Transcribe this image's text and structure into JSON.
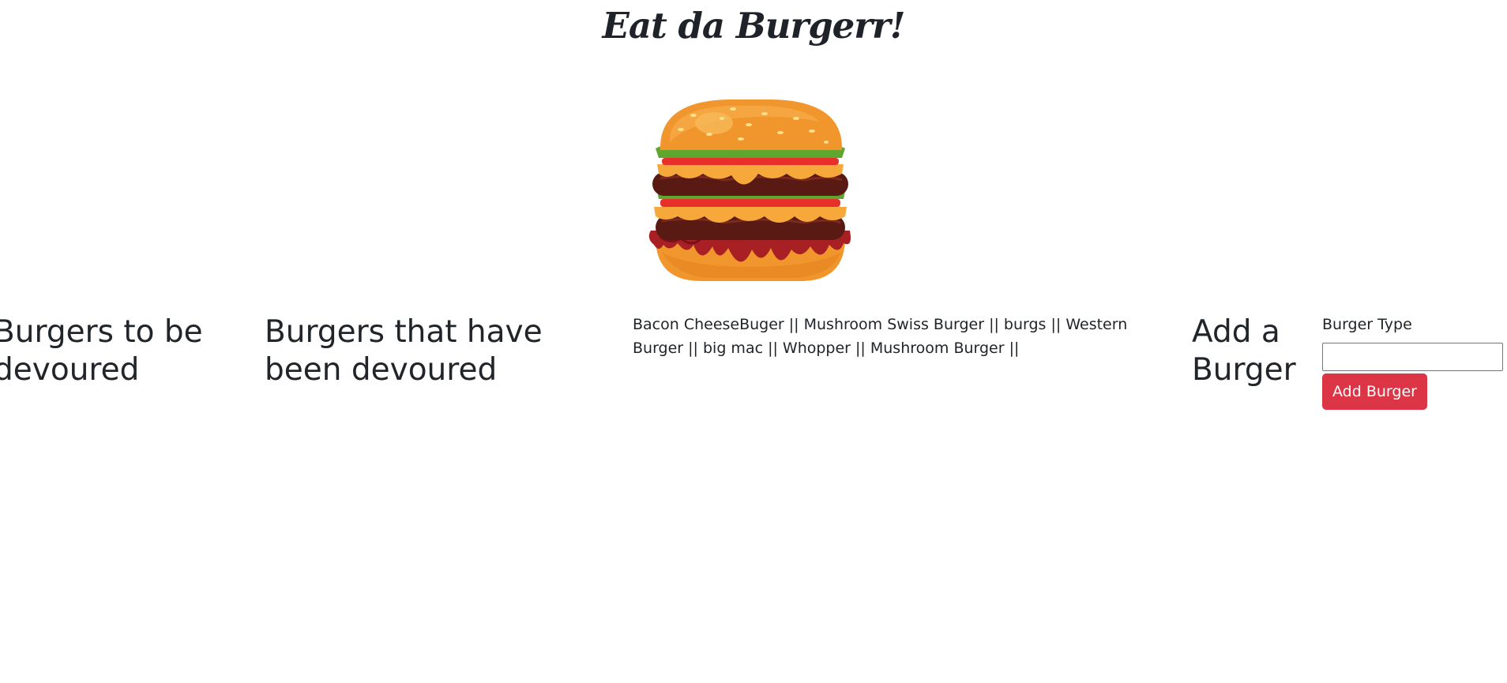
{
  "header": {
    "title": "Eat da Burgerr!"
  },
  "hero": {
    "image_icon": "burger-illustration"
  },
  "columns": {
    "to_be_devoured_heading": "Burgers to be devoured",
    "devoured_heading": "Burgers that have been devoured",
    "burger_list_text": "Bacon CheeseBuger || Mushroom Swiss Burger || burgs || Western Burger || big mac || Whopper || Mushroom Burger ||"
  },
  "add_form": {
    "heading": "Add a Burger",
    "label": "Burger Type",
    "input_value": "",
    "button_label": "Add Burger"
  },
  "colors": {
    "button": "#dc3545",
    "text": "#212529"
  }
}
